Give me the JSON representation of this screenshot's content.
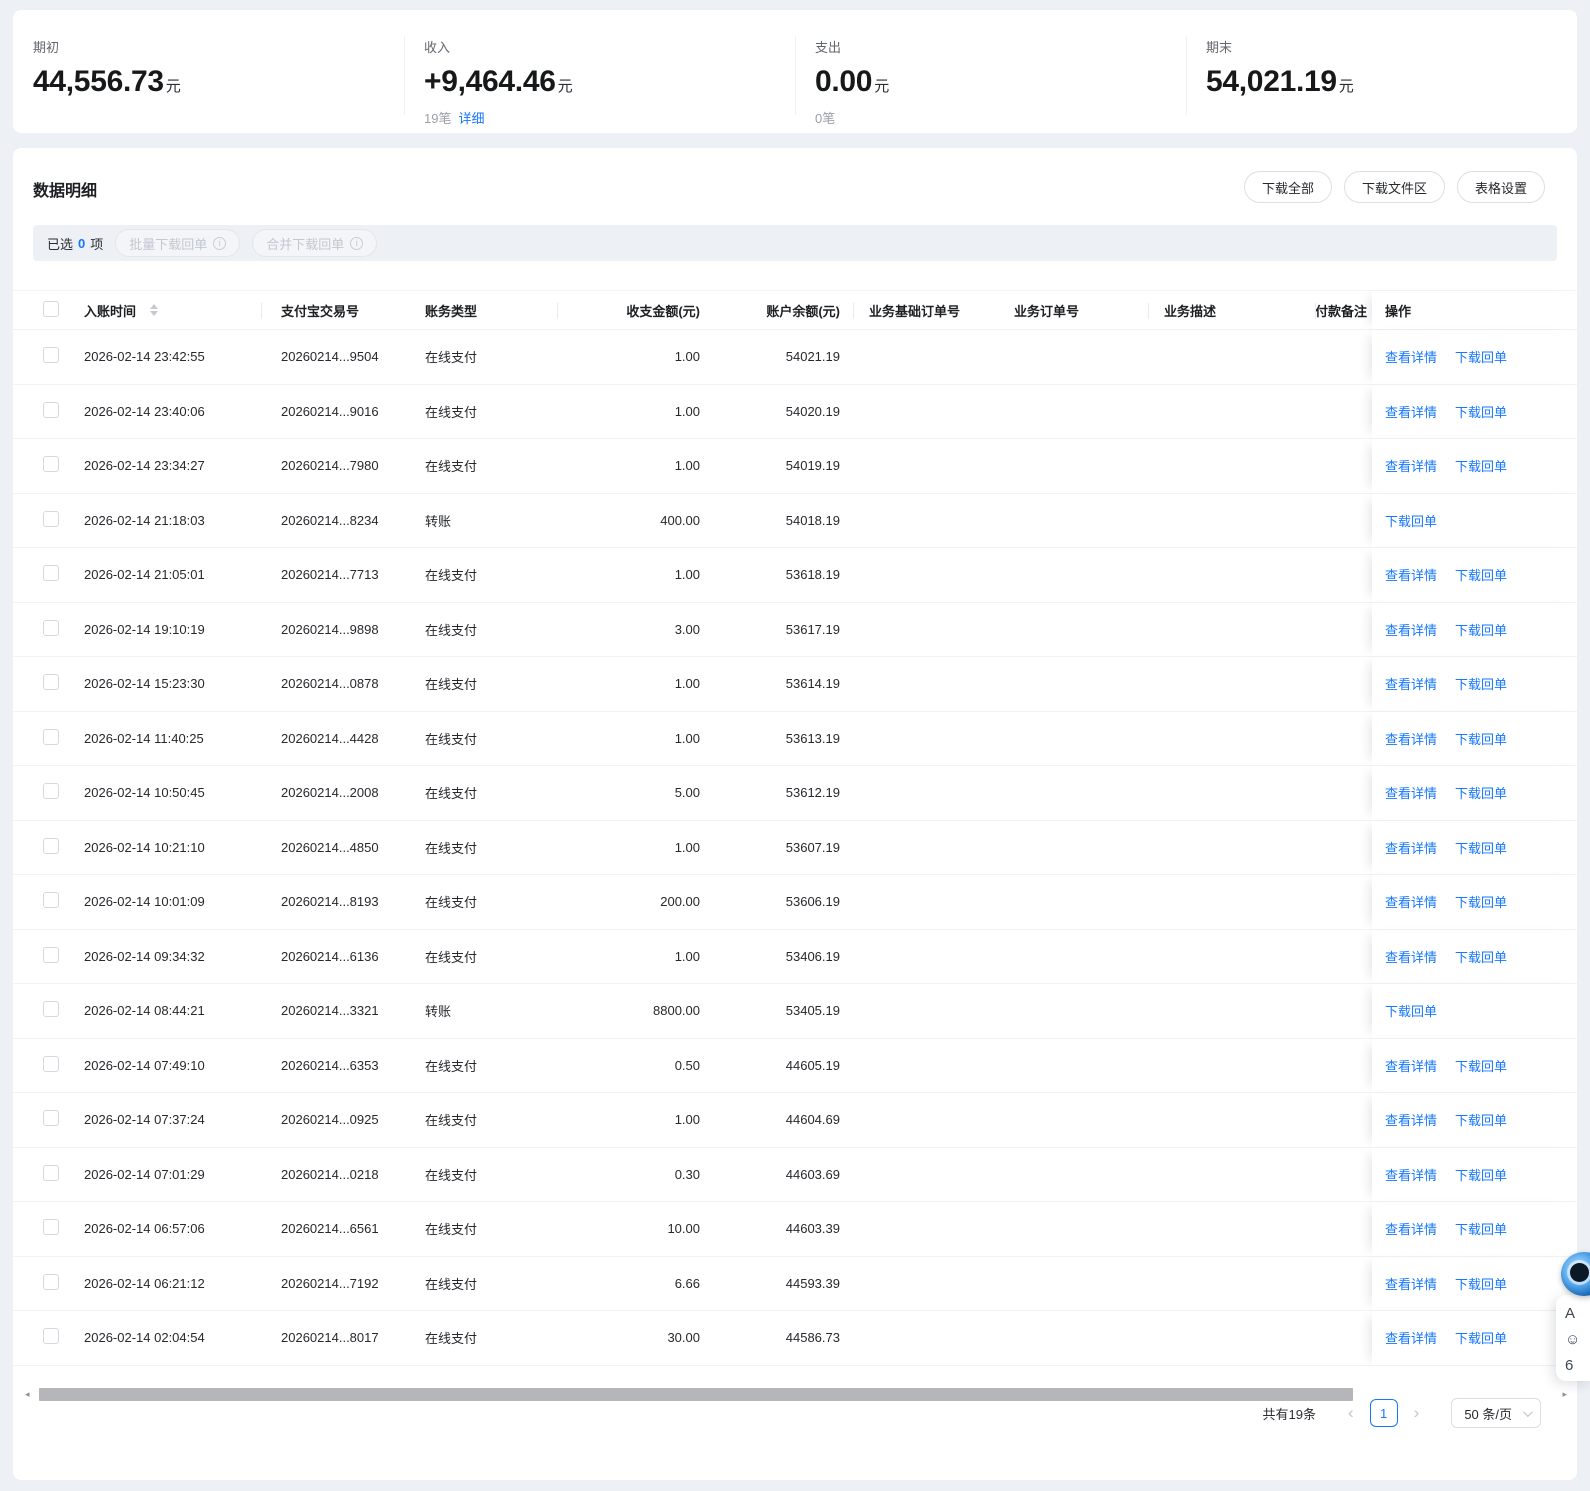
{
  "colors": {
    "accent": "#1677ff",
    "page_bg": "#edf0f5"
  },
  "summary": {
    "cards": [
      {
        "label": "期初",
        "value": "44,556.73",
        "unit": "元",
        "count": "",
        "link": ""
      },
      {
        "label": "收入",
        "value": "+9,464.46",
        "unit": "元",
        "count": "19笔",
        "link": "详细"
      },
      {
        "label": "支出",
        "value": "0.00",
        "unit": "元",
        "count": "0笔",
        "link": ""
      },
      {
        "label": "期末",
        "value": "54,021.19",
        "unit": "元",
        "count": "",
        "link": ""
      }
    ]
  },
  "detail": {
    "title": "数据明细",
    "toolbar": {
      "download_all": "下载全部",
      "download_zone": "下载文件区",
      "table_settings": "表格设置"
    },
    "selection": {
      "prefix": "已选",
      "count": "0",
      "suffix": "项",
      "batch": "批量下载回单",
      "merge": "合并下载回单"
    },
    "table": {
      "columns": [
        "入账时间",
        "支付宝交易号",
        "账务类型",
        "收支金额(元)",
        "账户余额(元)",
        "业务基础订单号",
        "业务订单号",
        "业务描述",
        "付款备注",
        "操作"
      ],
      "action_detail": "查看详情",
      "action_receipt": "下载回单",
      "rows": [
        {
          "time": "2026-02-14 23:42:55",
          "txid": "20260214...9504",
          "type": "在线支付",
          "amount": "1.00",
          "balance": "54021.19",
          "has_detail": true
        },
        {
          "time": "2026-02-14 23:40:06",
          "txid": "20260214...9016",
          "type": "在线支付",
          "amount": "1.00",
          "balance": "54020.19",
          "has_detail": true
        },
        {
          "time": "2026-02-14 23:34:27",
          "txid": "20260214...7980",
          "type": "在线支付",
          "amount": "1.00",
          "balance": "54019.19",
          "has_detail": true
        },
        {
          "time": "2026-02-14 21:18:03",
          "txid": "20260214...8234",
          "type": "转账",
          "amount": "400.00",
          "balance": "54018.19",
          "has_detail": false
        },
        {
          "time": "2026-02-14 21:05:01",
          "txid": "20260214...7713",
          "type": "在线支付",
          "amount": "1.00",
          "balance": "53618.19",
          "has_detail": true
        },
        {
          "time": "2026-02-14 19:10:19",
          "txid": "20260214...9898",
          "type": "在线支付",
          "amount": "3.00",
          "balance": "53617.19",
          "has_detail": true
        },
        {
          "time": "2026-02-14 15:23:30",
          "txid": "20260214...0878",
          "type": "在线支付",
          "amount": "1.00",
          "balance": "53614.19",
          "has_detail": true
        },
        {
          "time": "2026-02-14 11:40:25",
          "txid": "20260214...4428",
          "type": "在线支付",
          "amount": "1.00",
          "balance": "53613.19",
          "has_detail": true
        },
        {
          "time": "2026-02-14 10:50:45",
          "txid": "20260214...2008",
          "type": "在线支付",
          "amount": "5.00",
          "balance": "53612.19",
          "has_detail": true
        },
        {
          "time": "2026-02-14 10:21:10",
          "txid": "20260214...4850",
          "type": "在线支付",
          "amount": "1.00",
          "balance": "53607.19",
          "has_detail": true
        },
        {
          "time": "2026-02-14 10:01:09",
          "txid": "20260214...8193",
          "type": "在线支付",
          "amount": "200.00",
          "balance": "53606.19",
          "has_detail": true
        },
        {
          "time": "2026-02-14 09:34:32",
          "txid": "20260214...6136",
          "type": "在线支付",
          "amount": "1.00",
          "balance": "53406.19",
          "has_detail": true
        },
        {
          "time": "2026-02-14 08:44:21",
          "txid": "20260214...3321",
          "type": "转账",
          "amount": "8800.00",
          "balance": "53405.19",
          "has_detail": false
        },
        {
          "time": "2026-02-14 07:49:10",
          "txid": "20260214...6353",
          "type": "在线支付",
          "amount": "0.50",
          "balance": "44605.19",
          "has_detail": true
        },
        {
          "time": "2026-02-14 07:37:24",
          "txid": "20260214...0925",
          "type": "在线支付",
          "amount": "1.00",
          "balance": "44604.69",
          "has_detail": true
        },
        {
          "time": "2026-02-14 07:01:29",
          "txid": "20260214...0218",
          "type": "在线支付",
          "amount": "0.30",
          "balance": "44603.69",
          "has_detail": true
        },
        {
          "time": "2026-02-14 06:57:06",
          "txid": "20260214...6561",
          "type": "在线支付",
          "amount": "10.00",
          "balance": "44603.39",
          "has_detail": true
        },
        {
          "time": "2026-02-14 06:21:12",
          "txid": "20260214...7192",
          "type": "在线支付",
          "amount": "6.66",
          "balance": "44593.39",
          "has_detail": true
        },
        {
          "time": "2026-02-14 02:04:54",
          "txid": "20260214...8017",
          "type": "在线支付",
          "amount": "30.00",
          "balance": "44586.73",
          "has_detail": true
        }
      ]
    },
    "pagination": {
      "total": "共有19条",
      "page": "1",
      "page_size": "50 条/页"
    }
  },
  "assistant": {
    "glyphs": [
      "A",
      "☺",
      "6"
    ]
  }
}
